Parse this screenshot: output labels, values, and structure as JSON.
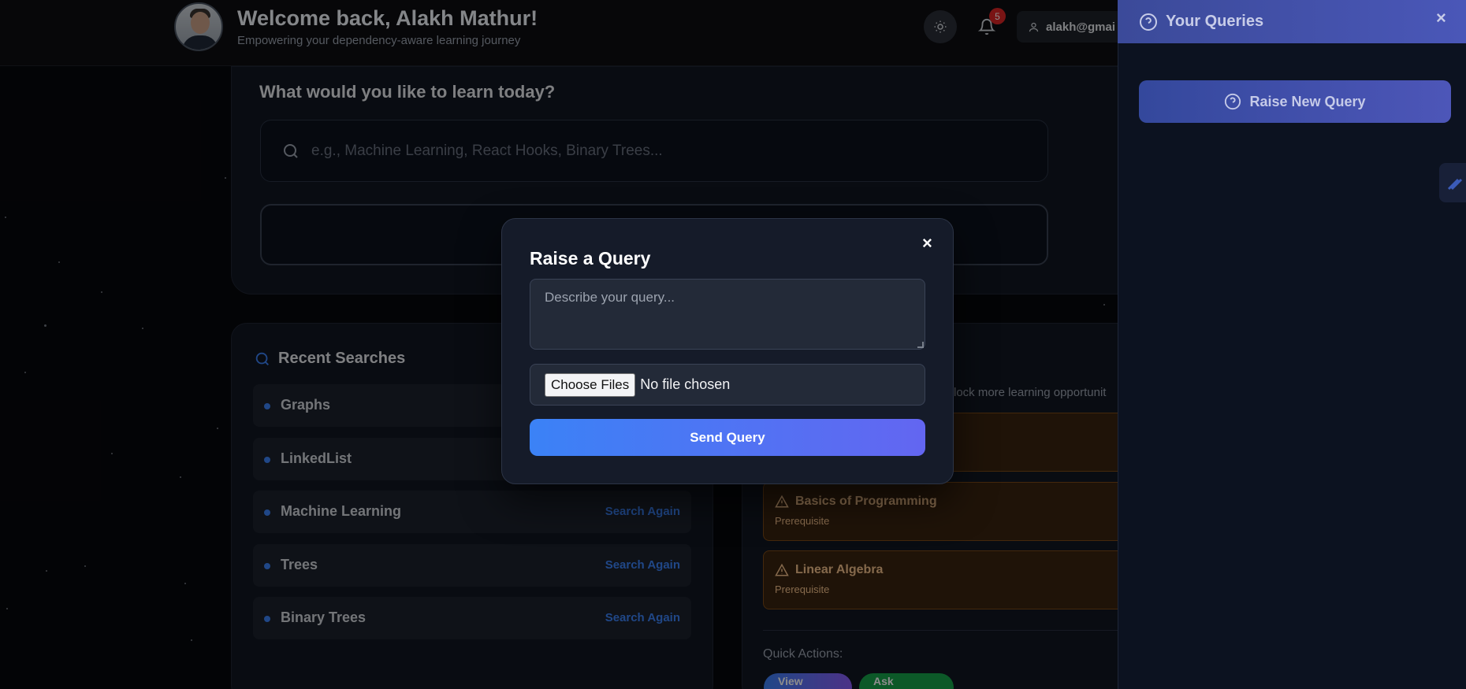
{
  "header": {
    "welcome": "Welcome back, Alakh Mathur!",
    "subtitle": "Empowering your dependency-aware learning journey",
    "notification_count": "5",
    "user_email": "alakh@gmai"
  },
  "learn": {
    "title": "What would you like to learn today?",
    "search_placeholder": "e.g., Machine Learning, React Hooks, Binary Trees..."
  },
  "recent": {
    "title": "Recent Searches",
    "items": [
      {
        "label": "Graphs",
        "action": ""
      },
      {
        "label": "LinkedList",
        "action": ""
      },
      {
        "label": "Machine Learning",
        "action": "Search Again"
      },
      {
        "label": "Trees",
        "action": "Search Again"
      },
      {
        "label": "Binary Trees",
        "action": "Search Again"
      }
    ]
  },
  "prereq": {
    "description": "lock more learning opportunit",
    "items": [
      {
        "name": "Basics of Programming",
        "tag": "Prerequisite"
      },
      {
        "name": "Linear Algebra",
        "tag": "Prerequisite"
      }
    ],
    "quick_actions_label": "Quick Actions:",
    "view_profile": "View Profile",
    "ask_assistant": "Ask Assistant"
  },
  "modal": {
    "title": "Raise a Query",
    "textarea_placeholder": "Describe your query...",
    "choose_files": "Choose Files",
    "no_file": "No file chosen",
    "send": "Send Query",
    "close": "×"
  },
  "side_panel": {
    "title": "Your Queries",
    "close": "×",
    "raise_new": "Raise New Query"
  },
  "colors": {
    "accent": "#3b82f6",
    "accent_purple": "#6366f1",
    "warning": "#f3c08a"
  }
}
